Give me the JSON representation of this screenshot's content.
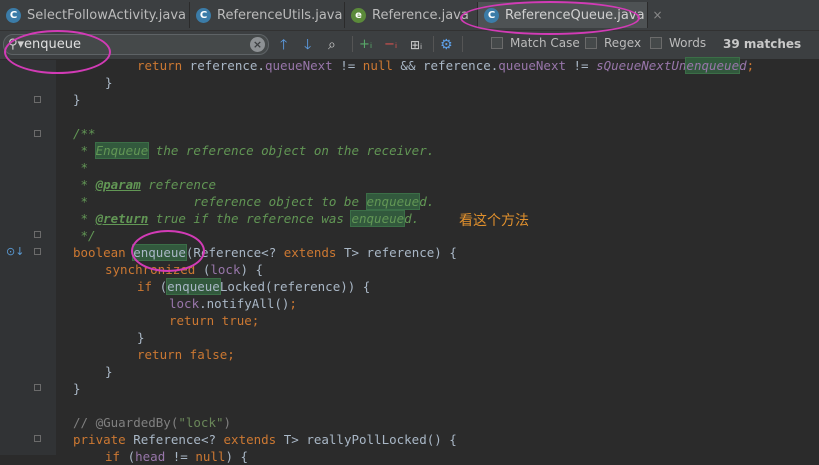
{
  "tabs": [
    {
      "label": "SelectFollowActivity.java",
      "icon": "C"
    },
    {
      "label": "ReferenceUtils.java",
      "icon": "C"
    },
    {
      "label": "Reference.java",
      "icon": "e"
    },
    {
      "label": "ReferenceQueue.java",
      "icon": "C"
    }
  ],
  "search": {
    "value": "enqueue",
    "options": {
      "match_case": "Match Case",
      "regex": "Regex",
      "words": "Words"
    },
    "matches": "39 matches"
  },
  "annotation": "看这个方法",
  "colors": {
    "accent_ring": "#d23bb6",
    "match_highlight": "#32593d",
    "annotation_text": "#e0902d"
  }
}
